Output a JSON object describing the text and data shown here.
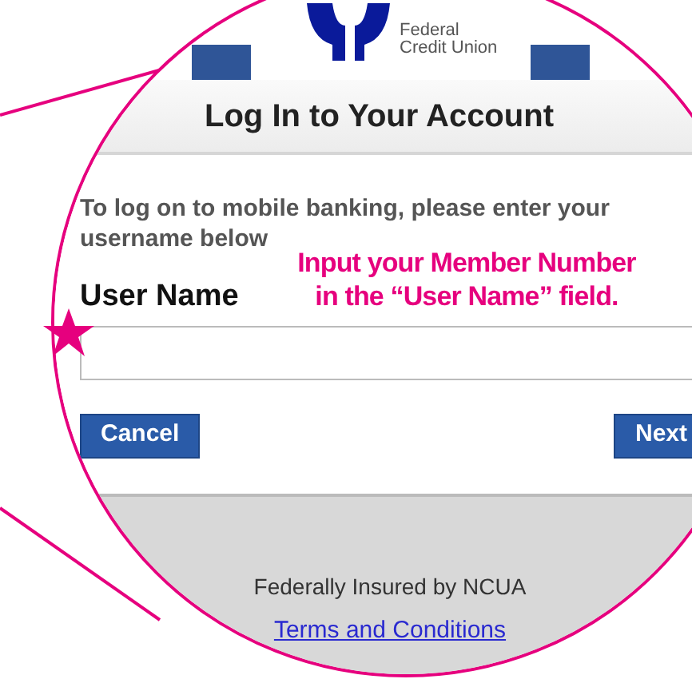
{
  "logo": {
    "lines": [
      "Federal",
      "Credit Union"
    ]
  },
  "title": "Log In to Your Account",
  "instructions": "To log on to mobile banking, please enter your username below",
  "field": {
    "label": "User Name"
  },
  "buttons": [
    {
      "label": "Cancel"
    },
    {
      "label": "Next"
    }
  ],
  "footer": {
    "insurance": "Federally Insured by NCUA",
    "link": "Terms and Conditions"
  },
  "annotation": {
    "lines": [
      "Input your Member Number",
      "in the “User Name” field."
    ]
  }
}
